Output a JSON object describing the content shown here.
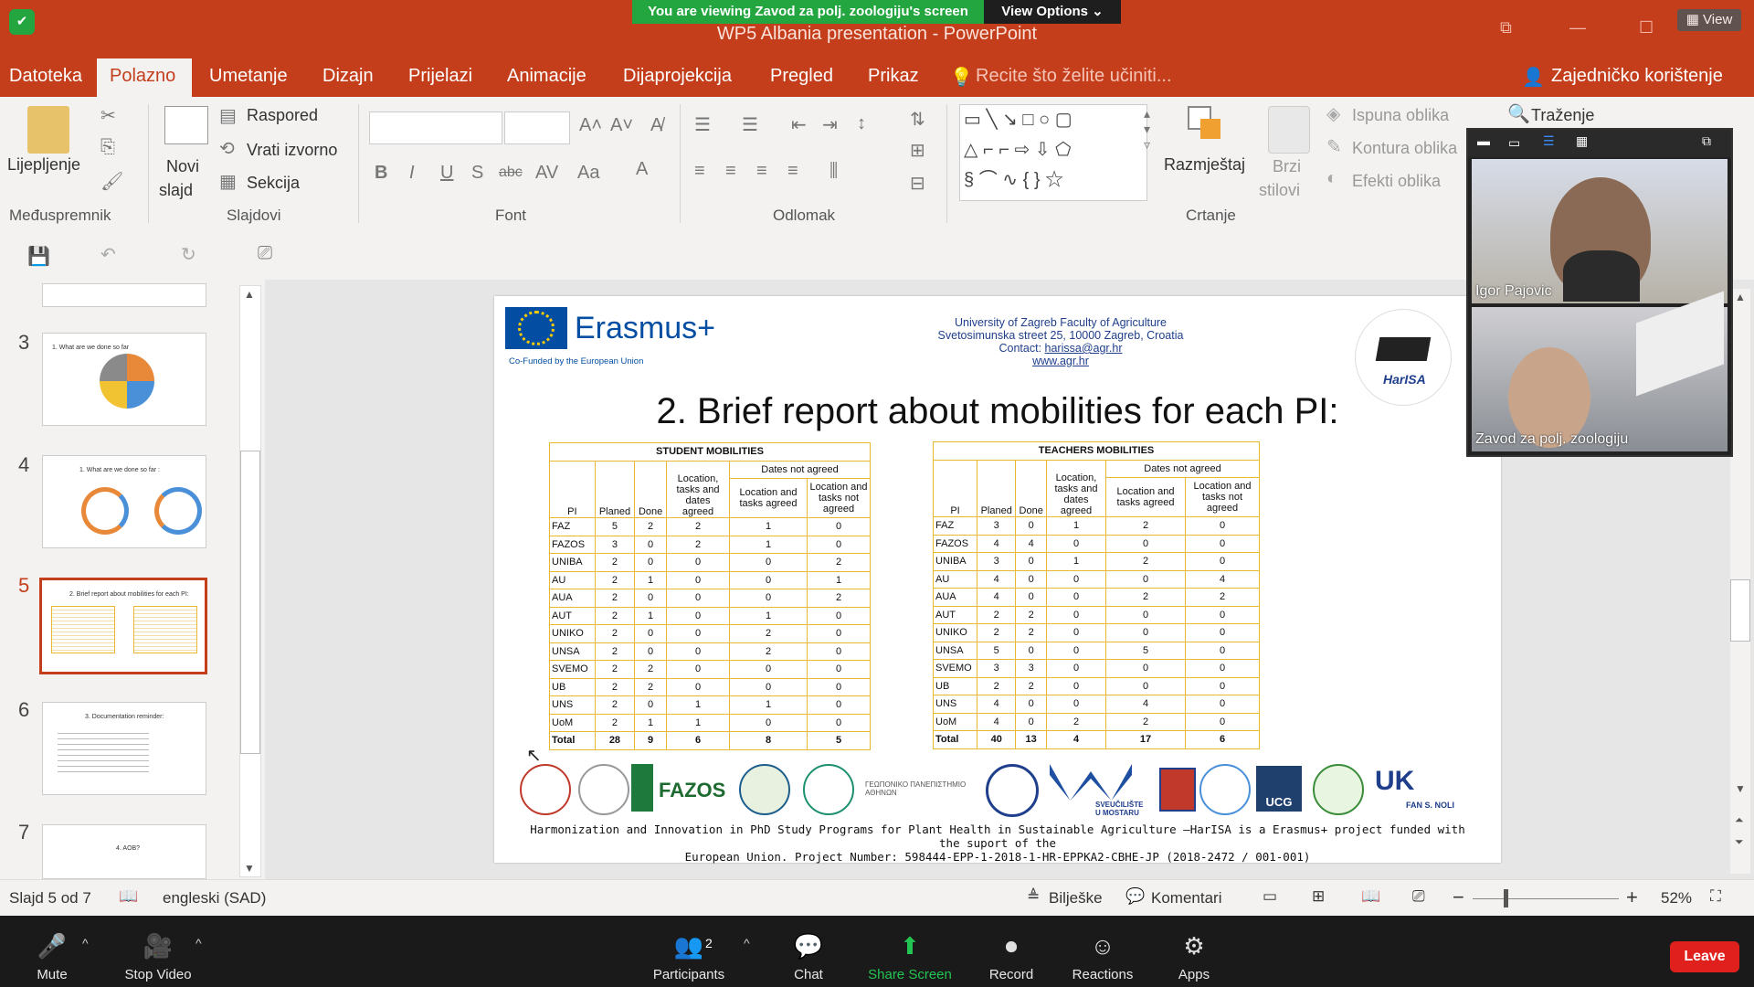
{
  "zoom_banner": {
    "viewing": "You are viewing Zavod za polj. zoologiju's screen",
    "view_options": "View Options",
    "view": "View"
  },
  "window": {
    "title": "WP5 Albania presentation - PowerPoint"
  },
  "menu": {
    "items": [
      "Datoteka",
      "Polazno",
      "Umetanje",
      "Dizajn",
      "Prijelazi",
      "Animacije",
      "Dijaprojekcija",
      "Pregled",
      "Prikaz"
    ],
    "active": "Polazno",
    "tell_me": "Recite što želite učiniti...",
    "share": "Zajedničko korištenje"
  },
  "ribbon": {
    "paste": "Lijepljenje",
    "clipboard_group": "Međuspremnik",
    "new_slide_1": "Novi",
    "new_slide_2": "slajd",
    "layout": "Raspored",
    "reset": "Vrati izvorno",
    "section": "Sekcija",
    "slides_group": "Slajdovi",
    "font_group": "Font",
    "paragraph_group": "Odlomak",
    "arrange": "Razmještaj",
    "quick_styles_1": "Brzi",
    "quick_styles_2": "stilovi",
    "shape_fill": "Ispuna oblika",
    "shape_outline": "Kontura oblika",
    "shape_effects": "Efekti oblika",
    "drawing_group": "Crtanje",
    "find": "Traženje"
  },
  "thumbnails": [
    {
      "num": "3",
      "title": "1. What are we done so far"
    },
    {
      "num": "4",
      "title": "1. What are we done so far :"
    },
    {
      "num": "5",
      "title": "2. Brief report about mobilities for each PI:"
    },
    {
      "num": "6",
      "title": "3. Documentation reminder:"
    },
    {
      "num": "7",
      "title": "4. AOB?"
    }
  ],
  "slide": {
    "erasmus": "Erasmus+",
    "cofunded": "Co-Funded by the European Union",
    "uni_line1": "University of Zagreb Faculty of Agriculture",
    "uni_line2": "Svetosimunska street 25, 10000 Zagreb, Croatia",
    "contact_label": "Contact: ",
    "contact_email": "harissa@agr.hr",
    "website": "www.agr.hr",
    "harisa": "HarISA",
    "title": "2. Brief report about mobilities for each PI:",
    "student_table": {
      "heading": "STUDENT MOBILITIES",
      "dates_not_agreed": "Dates not agreed",
      "columns": [
        "PI",
        "Planed",
        "Done",
        "Location, tasks and dates agreed",
        "Location and tasks agreed",
        "Location and tasks not agreed"
      ],
      "rows": [
        [
          "FAZ",
          "5",
          "2",
          "2",
          "1",
          "0"
        ],
        [
          "FAZOS",
          "3",
          "0",
          "2",
          "1",
          "0"
        ],
        [
          "UNIBA",
          "2",
          "0",
          "0",
          "0",
          "2"
        ],
        [
          "AU",
          "2",
          "1",
          "0",
          "0",
          "1"
        ],
        [
          "AUA",
          "2",
          "0",
          "0",
          "0",
          "2"
        ],
        [
          "AUT",
          "2",
          "1",
          "0",
          "1",
          "0"
        ],
        [
          "UNIKO",
          "2",
          "0",
          "0",
          "2",
          "0"
        ],
        [
          "UNSA",
          "2",
          "0",
          "0",
          "2",
          "0"
        ],
        [
          "SVEMO",
          "2",
          "2",
          "0",
          "0",
          "0"
        ],
        [
          "UB",
          "2",
          "2",
          "0",
          "0",
          "0"
        ],
        [
          "UNS",
          "2",
          "0",
          "1",
          "1",
          "0"
        ],
        [
          "UoM",
          "2",
          "1",
          "1",
          "0",
          "0"
        ],
        [
          "Total",
          "28",
          "9",
          "6",
          "8",
          "5"
        ]
      ]
    },
    "teacher_table": {
      "heading": "TEACHERS MOBILITIES",
      "dates_not_agreed": "Dates not agreed",
      "columns": [
        "PI",
        "Planed",
        "Done",
        "Location, tasks and dates agreed",
        "Location and tasks agreed",
        "Location and tasks not agreed"
      ],
      "rows": [
        [
          "FAZ",
          "3",
          "0",
          "1",
          "2",
          "0"
        ],
        [
          "FAZOS",
          "4",
          "4",
          "0",
          "0",
          "0"
        ],
        [
          "UNIBA",
          "3",
          "0",
          "1",
          "2",
          "0"
        ],
        [
          "AU",
          "4",
          "0",
          "0",
          "0",
          "4"
        ],
        [
          "AUA",
          "4",
          "0",
          "0",
          "2",
          "2"
        ],
        [
          "AUT",
          "2",
          "2",
          "0",
          "0",
          "0"
        ],
        [
          "UNIKO",
          "2",
          "2",
          "0",
          "0",
          "0"
        ],
        [
          "UNSA",
          "5",
          "0",
          "0",
          "5",
          "0"
        ],
        [
          "SVEMO",
          "3",
          "3",
          "0",
          "0",
          "0"
        ],
        [
          "UB",
          "2",
          "2",
          "0",
          "0",
          "0"
        ],
        [
          "UNS",
          "4",
          "0",
          "0",
          "4",
          "0"
        ],
        [
          "UoM",
          "4",
          "0",
          "2",
          "2",
          "0"
        ],
        [
          "Total",
          "40",
          "13",
          "4",
          "17",
          "6"
        ]
      ]
    },
    "logos": {
      "fazos": "FAZOS",
      "athens": "ΓΕΩΠΟΝΙΚΟ ΠΑΝΕΠΙΣΤΗΜΙΟ ΑΘΗΝΩΝ",
      "mostar": "SVEUČILIŠTE U MOSTARU",
      "ucg": "UCG",
      "fan": "FAN S. NOLI"
    },
    "footer_line1": "Harmonization and Innovation in PhD Study Programs for Plant Health in Sustainable Agriculture –HarISA is a Erasmus+ project funded with the suport of the",
    "footer_line2": "European Union. Project Number: 598444-EPP-1-2018-1-HR-EPPKA2-CBHE-JP (2018-2472 / 001-001)"
  },
  "status": {
    "slide": "Slajd 5 od 7",
    "language": "engleski (SAD)",
    "notes": "Bilješke",
    "comments": "Komentari",
    "zoom": "52%"
  },
  "video": [
    {
      "name": "Igor Pajovic"
    },
    {
      "name": "Zavod za polj. zoologiju"
    }
  ],
  "zoom_controls": {
    "mute": "Mute",
    "stop_video": "Stop Video",
    "participants": "Participants",
    "participants_count": "2",
    "chat": "Chat",
    "share_screen": "Share Screen",
    "record": "Record",
    "reactions": "Reactions",
    "apps": "Apps",
    "leave": "Leave"
  }
}
